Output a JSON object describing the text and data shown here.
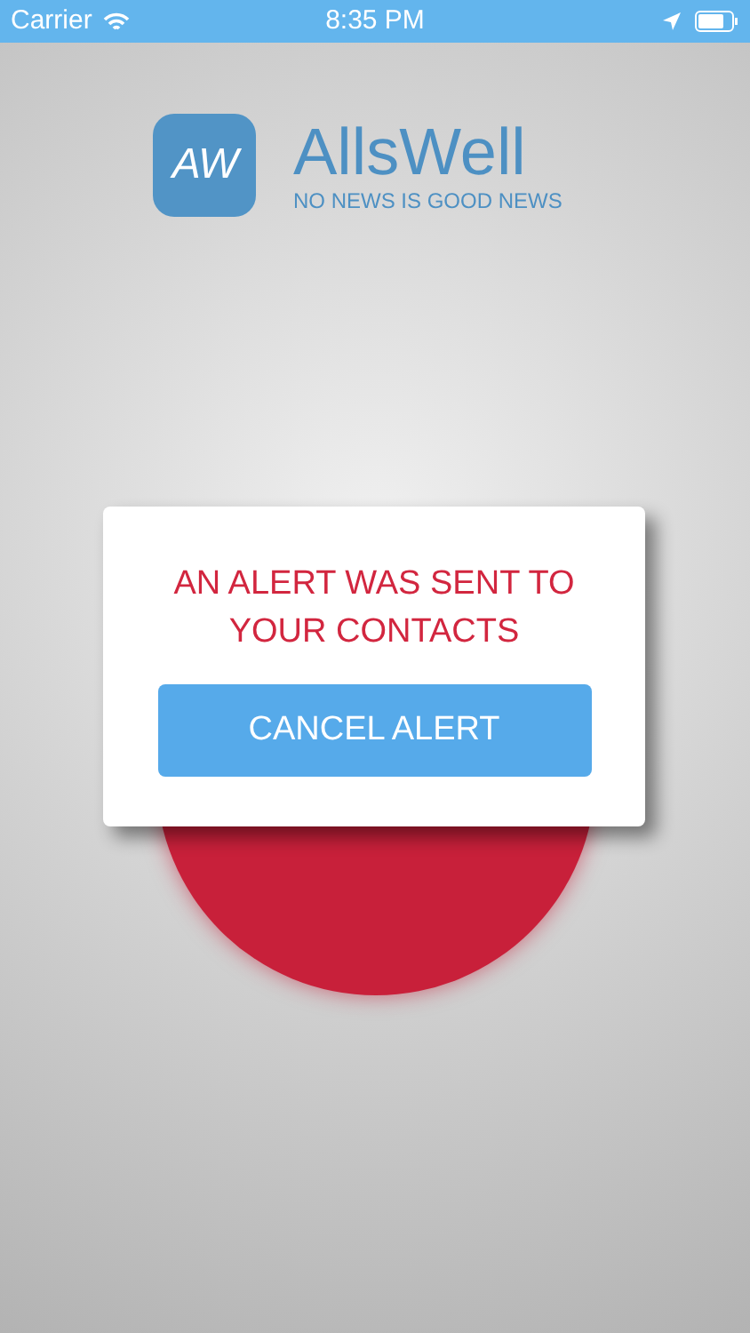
{
  "status_bar": {
    "carrier": "Carrier",
    "time": "8:35 PM"
  },
  "logo": {
    "mark": "AW",
    "name": "AllsWell",
    "tagline": "NO NEWS IS GOOD NEWS"
  },
  "dialog": {
    "message": "AN ALERT WAS SENT TO YOUR CONTACTS",
    "button": "CANCEL ALERT"
  }
}
